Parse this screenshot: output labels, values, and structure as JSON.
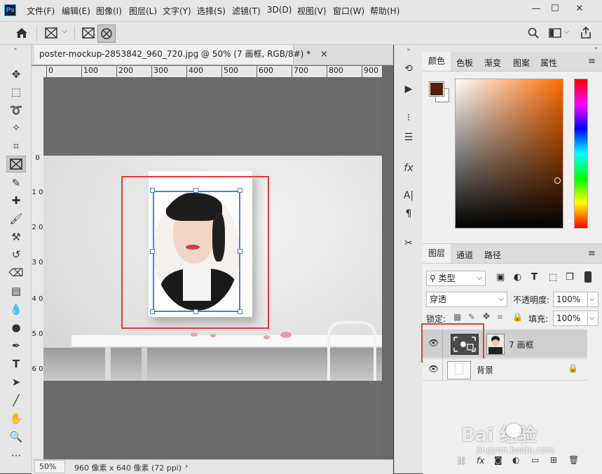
{
  "app": {
    "logo": "Ps"
  },
  "menu": [
    "文件(F)",
    "编辑(E)",
    "图像(I)",
    "图层(L)",
    "文字(Y)",
    "选择(S)",
    "滤镜(T)",
    "3D(D)",
    "视图(V)",
    "窗口(W)",
    "帮助(H)"
  ],
  "window_controls": {
    "minimize": "—",
    "maximize": "☐",
    "close": "✕"
  },
  "document": {
    "tab_title": "poster-mockup-2853842_960_720.jpg @ 50% (7 画框, RGB/8#) *",
    "tab_close": "×",
    "ruler_h": [
      "0",
      "100",
      "200",
      "300",
      "400",
      "500",
      "600",
      "700",
      "800",
      "900"
    ],
    "ruler_v": [
      "0",
      "1 0",
      "2 0",
      "3 0",
      "4 0",
      "5 0",
      "6 0"
    ],
    "zoom": "50%",
    "doc_size": "960 像素 x 640 像素 (72 ppi)",
    "status_arrow": "›"
  },
  "color_panel": {
    "tabs": [
      "颜色",
      "色板",
      "渐变",
      "图案",
      "属性"
    ],
    "foreground": "#5a1e0e",
    "background": "#ffffff",
    "hue_color": "#ff6a00"
  },
  "layers_panel": {
    "tabs": [
      "图层",
      "通道",
      "路径"
    ],
    "filter_kind": "类型",
    "blend_mode": "穿透",
    "opacity_label": "不透明度:",
    "opacity_value": "100%",
    "lock_label": "锁定:",
    "fill_label": "填充:",
    "fill_value": "100%",
    "layers": [
      {
        "name": "7 画框",
        "visible": true,
        "selected": true
      },
      {
        "name": "背景",
        "visible": true,
        "locked": true
      }
    ]
  },
  "watermark": {
    "brand": "Bai  经验",
    "url": "jingyan.baidu.com"
  }
}
